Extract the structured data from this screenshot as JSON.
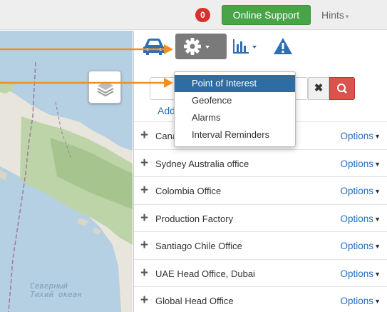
{
  "topbar": {
    "notification_count": "0",
    "support_label": "Online Support",
    "hints_label": "Hints"
  },
  "map": {
    "ocean_label_line1": "Северный",
    "ocean_label_line2": "Тихий океан"
  },
  "toolbar": {
    "icons": [
      "car-icon",
      "gear-icon",
      "bar-chart-icon",
      "warning-icon"
    ]
  },
  "search": {
    "value": "",
    "clear_label": "✖"
  },
  "add_link": "Add",
  "dropdown": {
    "items": [
      {
        "label": "Point of Interest",
        "active": true
      },
      {
        "label": "Geofence",
        "active": false
      },
      {
        "label": "Alarms",
        "active": false
      },
      {
        "label": "Interval Reminders",
        "active": false
      }
    ]
  },
  "list": {
    "options_label": "Options",
    "rows": [
      {
        "name": "Cana"
      },
      {
        "name": "Sydney Australia office"
      },
      {
        "name": "Colombia Office"
      },
      {
        "name": "Production Factory"
      },
      {
        "name": "Santiago Chile Office"
      },
      {
        "name": "UAE Head Office, Dubai"
      },
      {
        "name": "Global Head Office"
      }
    ]
  },
  "colors": {
    "accent_orange": "#f0901e",
    "support_green": "#47a447",
    "search_red": "#d9534f",
    "link_blue": "#2a6ebb",
    "dropdown_active": "#2e6da4"
  }
}
